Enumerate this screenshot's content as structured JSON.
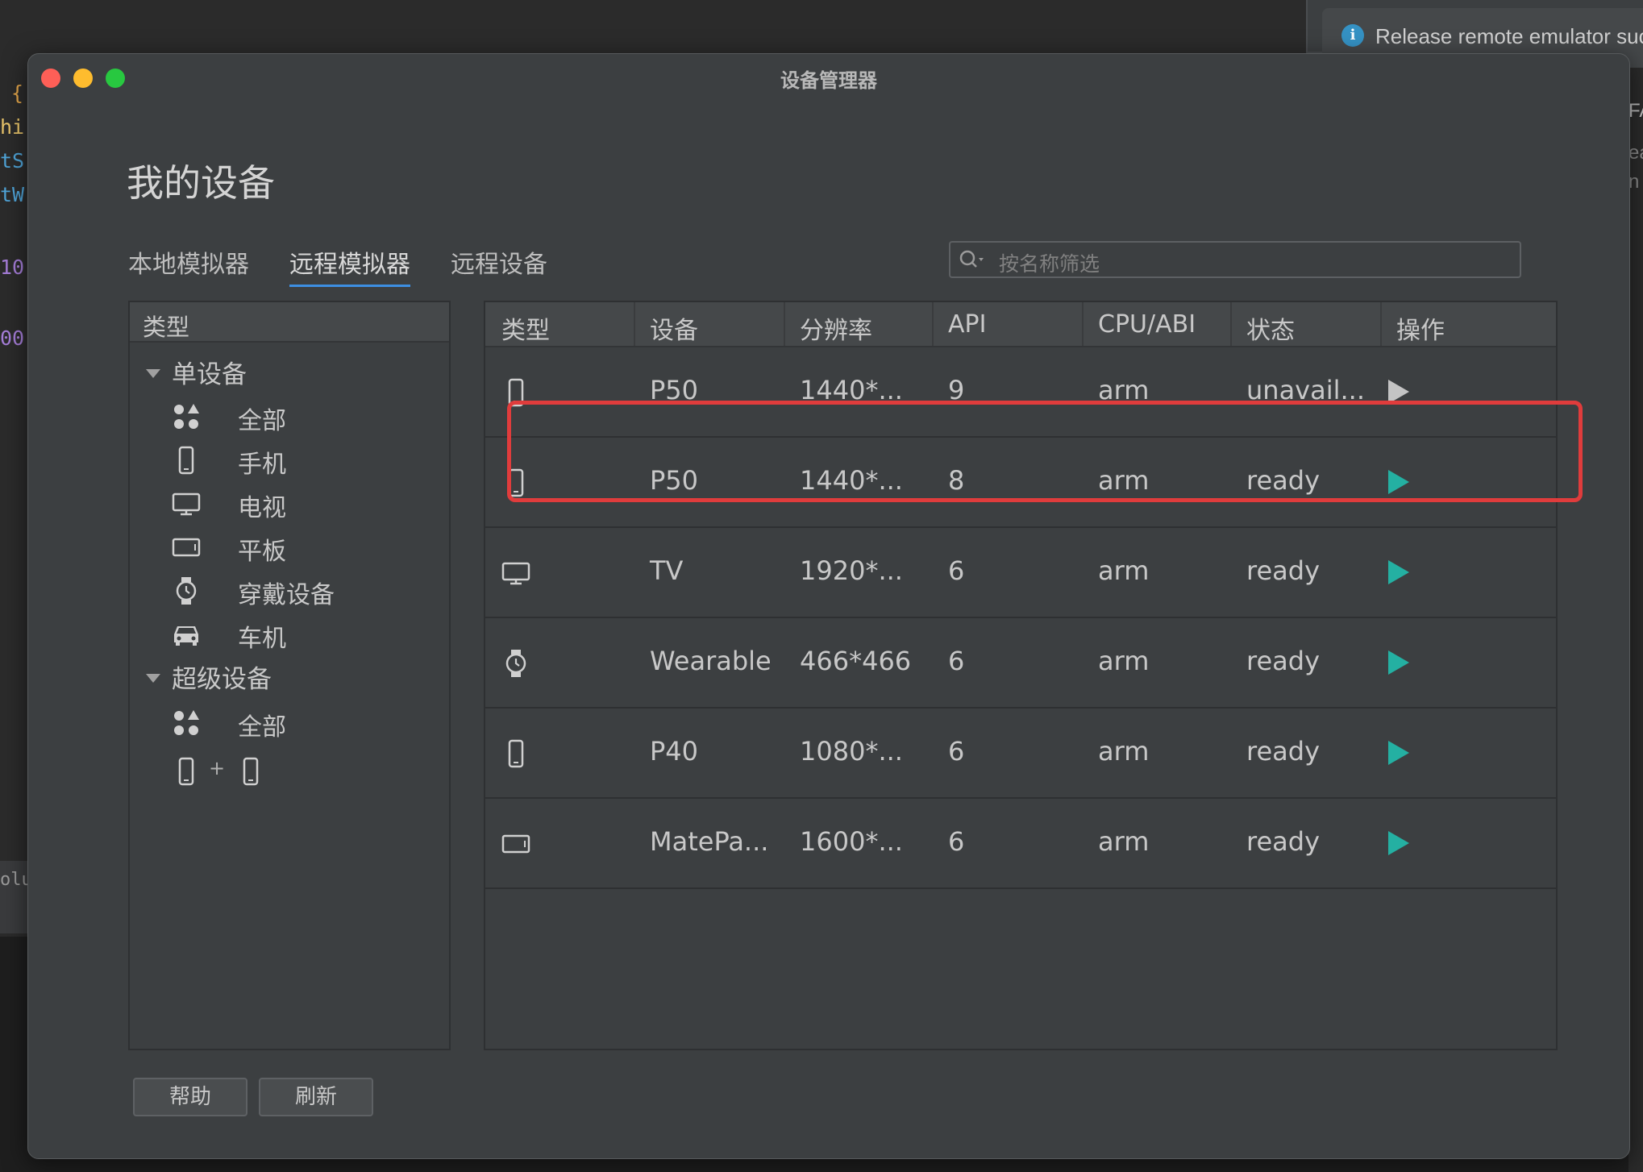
{
  "background": {
    "notification_text": "Release remote emulator suc",
    "notification_icon": "info-icon",
    "code_fragments": [
      "{",
      "hi",
      "tS",
      "tW",
      "10",
      "00",
      "olu"
    ],
    "right_fragments": [
      "FA",
      "ea",
      "n"
    ]
  },
  "window": {
    "title": "设备管理器",
    "traffic_lights": [
      "close",
      "minimize",
      "maximize"
    ]
  },
  "heading": "我的设备",
  "tabs": [
    {
      "label": "本地模拟器",
      "active": false
    },
    {
      "label": "远程模拟器",
      "active": true
    },
    {
      "label": "远程设备",
      "active": false
    }
  ],
  "search": {
    "placeholder": "按名称筛选"
  },
  "categories": {
    "header": "类型",
    "groups": [
      {
        "label": "单设备",
        "items": [
          {
            "label": "全部",
            "icon": "all-grid-icon"
          },
          {
            "label": "手机",
            "icon": "phone-icon"
          },
          {
            "label": "电视",
            "icon": "tv-icon"
          },
          {
            "label": "平板",
            "icon": "tablet-icon"
          },
          {
            "label": "穿戴设备",
            "icon": "watch-icon"
          },
          {
            "label": "车机",
            "icon": "car-icon"
          }
        ]
      },
      {
        "label": "超级设备",
        "items": [
          {
            "label": "全部",
            "icon": "all-grid-icon"
          }
        ],
        "combo": "+"
      }
    ]
  },
  "table": {
    "columns": [
      "类型",
      "设备",
      "分辨率",
      "API",
      "CPU/ABI",
      "状态",
      "操作"
    ],
    "rows": [
      {
        "type_icon": "phone-icon",
        "device": "P50",
        "resolution": "1440*...",
        "api": "9",
        "cpu": "arm",
        "status": "unavail...",
        "action": "play-disabled"
      },
      {
        "type_icon": "phone-icon",
        "device": "P50",
        "resolution": "1440*...",
        "api": "8",
        "cpu": "arm",
        "status": "ready",
        "action": "play"
      },
      {
        "type_icon": "tv-icon",
        "device": "TV",
        "resolution": "1920*...",
        "api": "6",
        "cpu": "arm",
        "status": "ready",
        "action": "play"
      },
      {
        "type_icon": "watch-icon",
        "device": "Wearable",
        "resolution": "466*466",
        "api": "6",
        "cpu": "arm",
        "status": "ready",
        "action": "play"
      },
      {
        "type_icon": "phone-icon",
        "device": "P40",
        "resolution": "1080*...",
        "api": "6",
        "cpu": "arm",
        "status": "ready",
        "action": "play"
      },
      {
        "type_icon": "tablet-icon",
        "device": "MatePa...",
        "resolution": "1600*...",
        "api": "6",
        "cpu": "arm",
        "status": "ready",
        "action": "play"
      }
    ]
  },
  "colors": {
    "play": "#24b0a2",
    "highlight": "#e03c3c",
    "tab_underline": "#3d8fe2"
  },
  "buttons": {
    "help": "帮助",
    "refresh": "刷新"
  }
}
